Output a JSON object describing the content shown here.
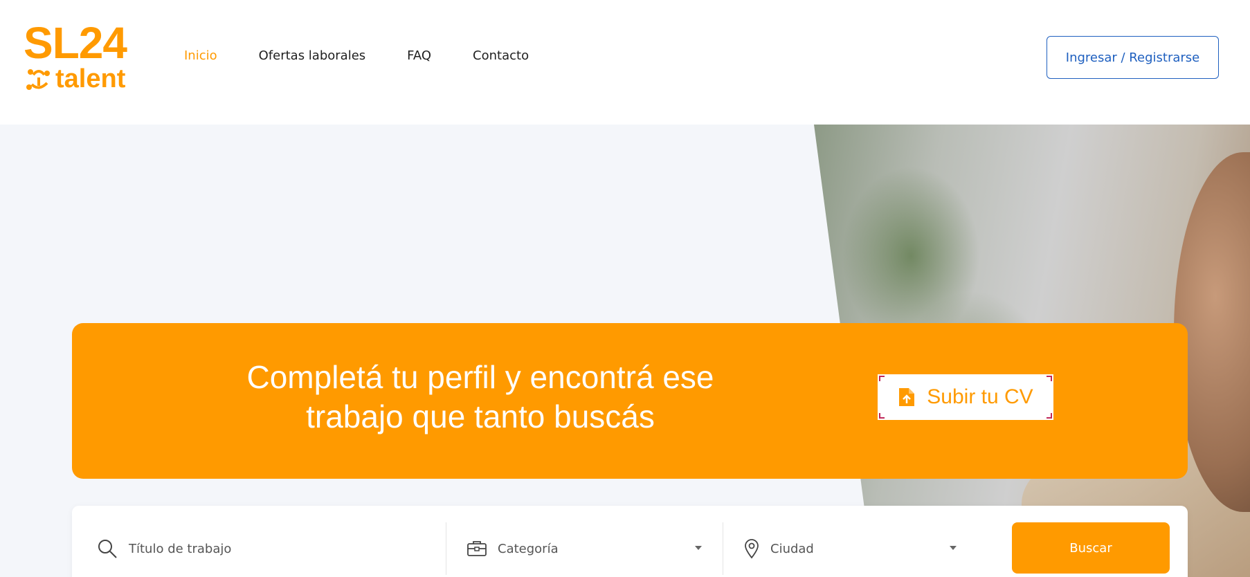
{
  "brand": {
    "logo_top": "SL24",
    "logo_bottom": "talent",
    "accent": "#ff9a00",
    "link_blue": "#1e5fbf"
  },
  "nav": {
    "items": [
      {
        "label": "Inicio",
        "active": true
      },
      {
        "label": "Ofertas laborales",
        "active": false
      },
      {
        "label": "FAQ",
        "active": false
      },
      {
        "label": "Contacto",
        "active": false
      }
    ]
  },
  "header": {
    "login_label": "Ingresar / Registrarse"
  },
  "banner": {
    "title_line1": "Completá tu perfil y encontrá ese",
    "title_line2": "trabajo que tanto buscás",
    "cv_button_label": "Subir tu CV",
    "cv_icon": "file-upload-icon"
  },
  "search": {
    "title_placeholder": "Título de trabajo",
    "category_label": "Categoría",
    "city_label": "Ciudad",
    "submit_label": "Buscar",
    "icons": {
      "title": "search-icon",
      "category": "briefcase-icon",
      "city": "location-pin-icon"
    }
  }
}
